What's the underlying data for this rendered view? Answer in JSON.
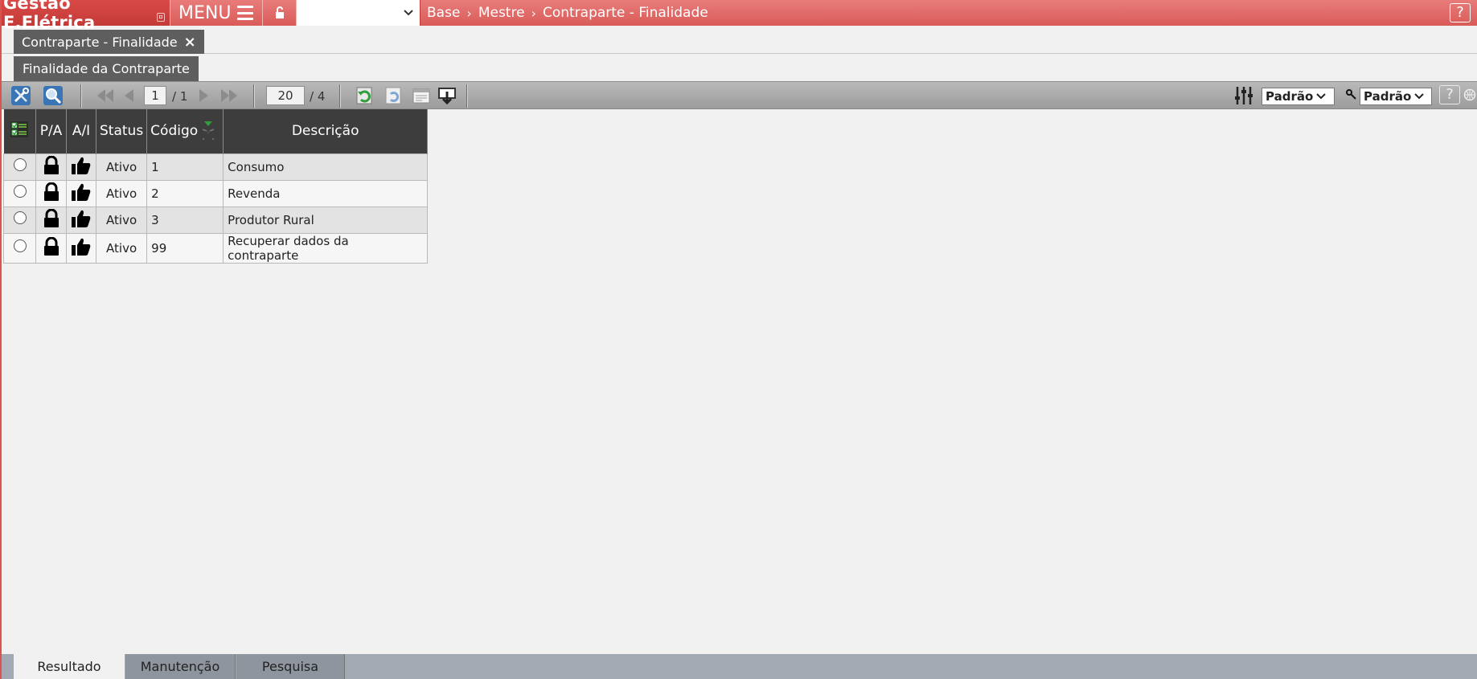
{
  "app": {
    "title": "Gestão E.Elétrica",
    "menu_label": "MENU",
    "help": "?"
  },
  "company_select": {
    "value": ""
  },
  "breadcrumb": [
    "Base",
    "Mestre",
    "Contraparte - Finalidade"
  ],
  "document_tab": {
    "label": "Contraparte - Finalidade",
    "close": "×"
  },
  "sub_tab": {
    "label": "Finalidade da Contraparte"
  },
  "toolbar": {
    "page_current": "1",
    "page_total": "/ 1",
    "page_size": "20",
    "record_total": "/ 4",
    "layout_select": "Padrão",
    "filter_select": "Padrão",
    "help": "?"
  },
  "grid": {
    "columns": [
      "P/A",
      "A/I",
      "Status",
      "Código",
      "Descrição"
    ],
    "rows": [
      {
        "status": "Ativo",
        "codigo": "1",
        "descricao": "Consumo"
      },
      {
        "status": "Ativo",
        "codigo": "2",
        "descricao": "Revenda"
      },
      {
        "status": "Ativo",
        "codigo": "3",
        "descricao": "Produtor Rural"
      },
      {
        "status": "Ativo",
        "codigo": "99",
        "descricao": "Recuperar dados da contraparte"
      }
    ]
  },
  "bottom_tabs": [
    "Resultado",
    "Manutenção",
    "Pesquisa"
  ],
  "colors": {
    "accent": "#d95b58",
    "header_dark": "#3d3d3d",
    "tab_gray": "#5e5e5e"
  }
}
